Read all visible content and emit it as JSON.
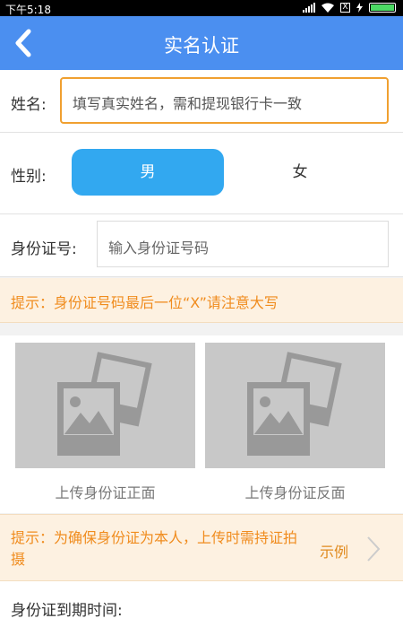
{
  "status_bar": {
    "time": "下午5:18",
    "sim_icon_text": "X"
  },
  "nav": {
    "back_icon": "chevron-left-icon",
    "title": "实名认证"
  },
  "form": {
    "name_label": "姓名:",
    "name_placeholder": "填写真实姓名，需和提现银行卡一致",
    "gender_label": "性别:",
    "gender_options": [
      "男",
      "女"
    ],
    "gender_selected": "男",
    "id_label": "身份证号:",
    "id_placeholder": "输入身份证号码"
  },
  "tip_id": "提示：身份证号码最后一位“X”请注意大写",
  "upload": {
    "front_label": "上传身份证正面",
    "back_label": "上传身份证反面",
    "icon": "photo-placeholder-icon"
  },
  "tip_photo": {
    "text": "提示：为确保身份证为本人，上传时需持证拍摄",
    "example_link": "示例"
  },
  "expire_label": "身份证到期时间:",
  "colors": {
    "nav_bg": "#4b8ff0",
    "accent_blue": "#32a8f0",
    "tip_bg": "#fdf1e1",
    "tip_text": "#f08c1e",
    "input_focus_border": "#f0a030"
  }
}
